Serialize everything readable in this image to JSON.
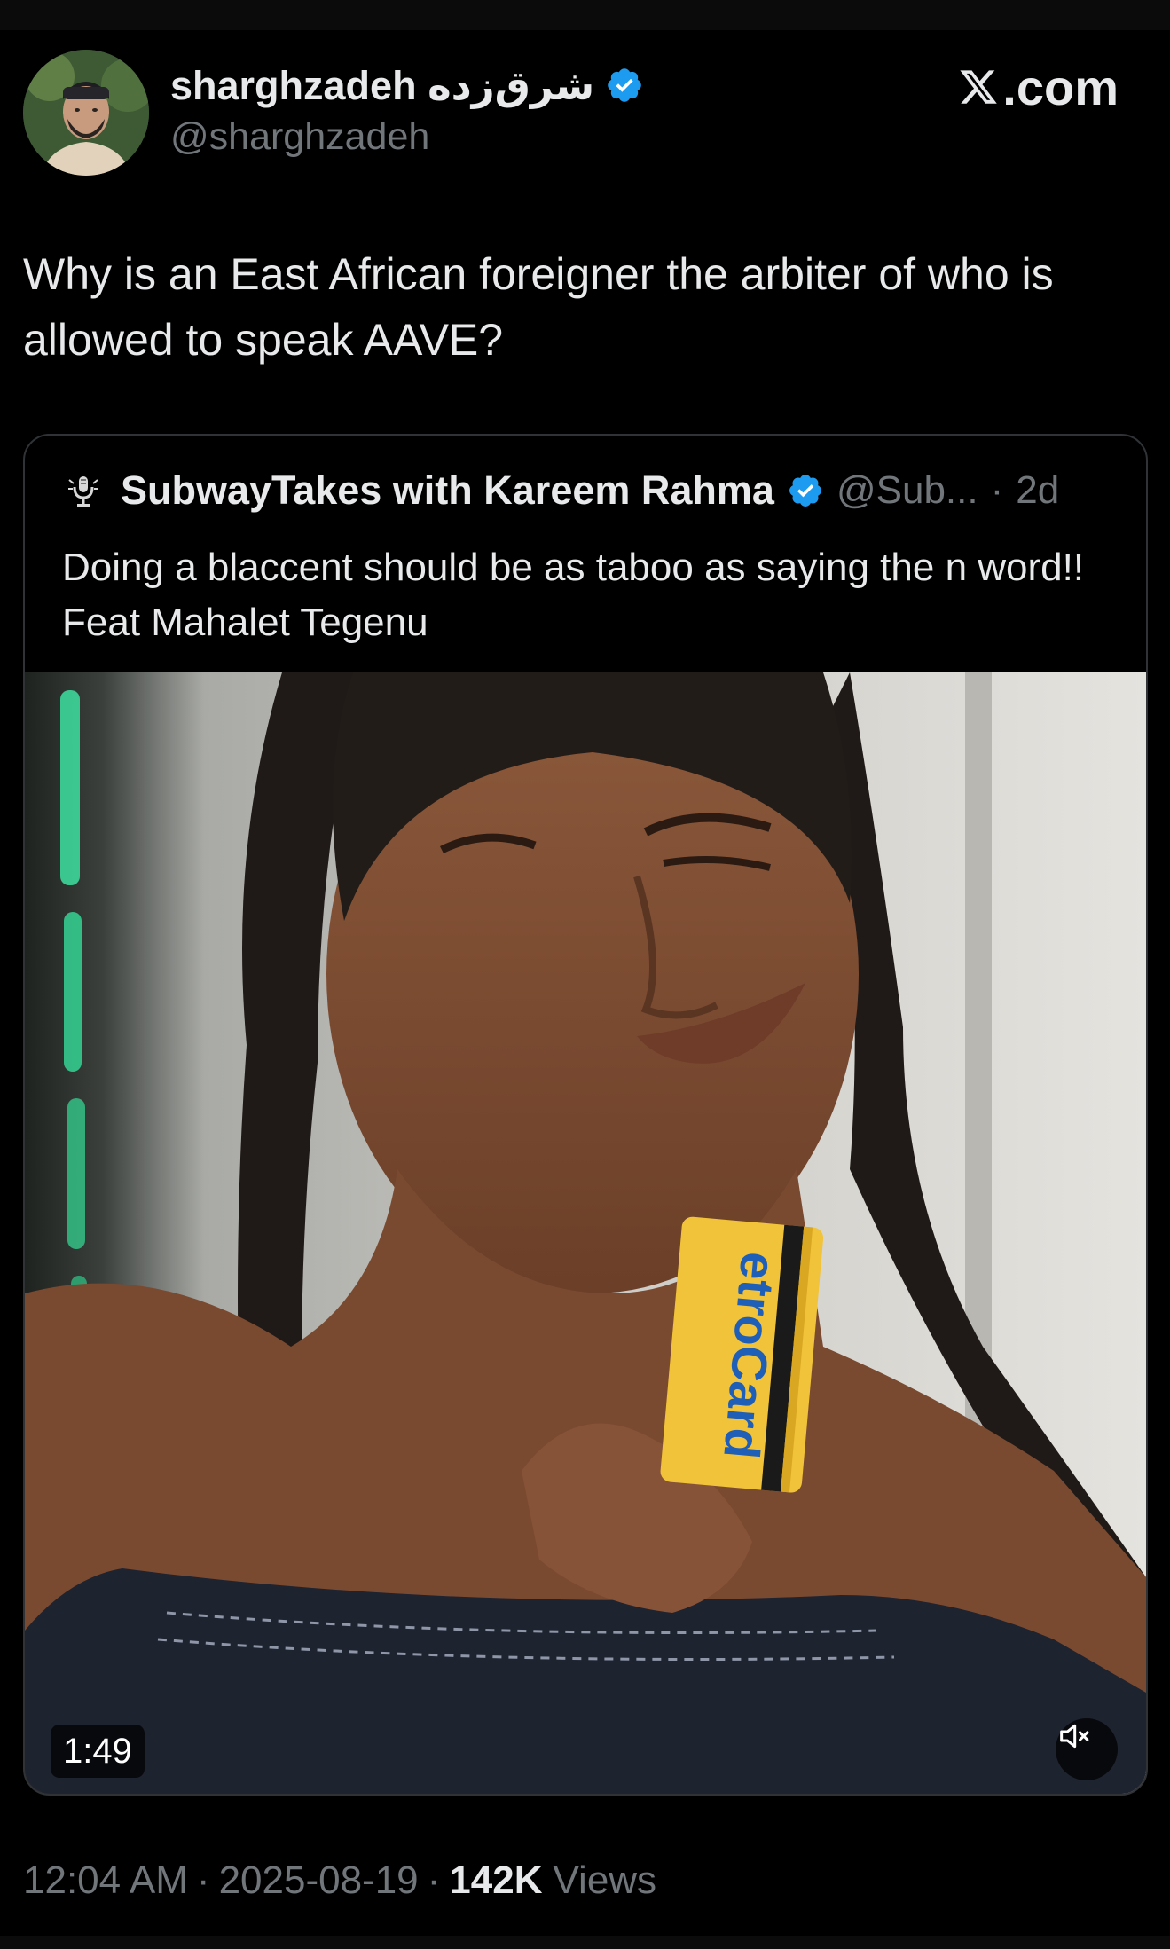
{
  "tweet": {
    "author": {
      "display_name": "sharghzadeh شرق‌زده",
      "handle": "@sharghzadeh",
      "verified": true,
      "avatar_icon": "profile-photo"
    },
    "site_logo": ".com",
    "text": "Why is an East African foreigner the arbiter of who is allowed to speak AAVE?",
    "quoted": {
      "display_name": "SubwayTakes with Kareem Rahma",
      "handle": "@Sub...",
      "separator": "·",
      "time_ago": "2d",
      "verified": true,
      "avatar_icon": "microphone-logo-icon",
      "text": "Doing a blaccent should be as taboo as saying the n word!! Feat Mahalet Tegenu",
      "video": {
        "duration": "1:49",
        "muted": true,
        "card_label": "etroCard"
      }
    },
    "meta": {
      "time": "12:04 AM",
      "separator": "·",
      "date": "2025-08-19",
      "views_count": "142K",
      "views_label": "Views"
    }
  },
  "colors": {
    "background": "#000000",
    "text_primary": "#e7e9ea",
    "text_secondary": "#71767b",
    "verified_blue": "#1d9bf0",
    "border": "#2f3336"
  }
}
